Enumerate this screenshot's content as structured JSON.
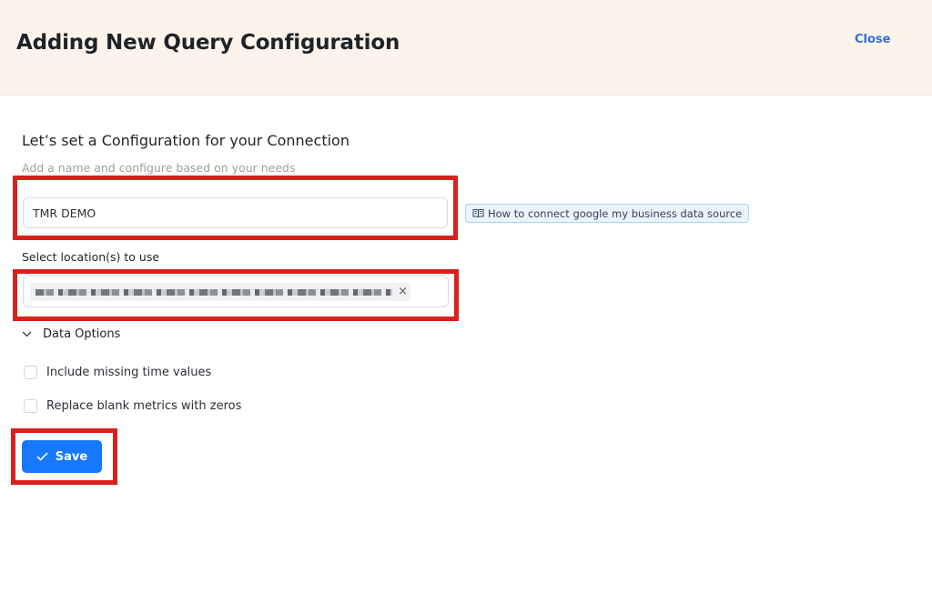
{
  "header": {
    "title": "Adding New Query Configuration",
    "close_label": "Close",
    "background_color": "#fcf3ea",
    "link_color": "#2f6fdd"
  },
  "form": {
    "title": "Let’s set a Configuration for your Connection",
    "subtitle": "Add a name and configure based on your needs",
    "name_value": "TMR DEMO",
    "help_link": {
      "icon": "book-icon",
      "label": "How to connect google my business data source"
    },
    "location_label": "Select location(s) to use",
    "location_remove_glyph": "×",
    "data_options_label": "Data Options",
    "options": [
      {
        "label": "Include missing time values",
        "checked": false
      },
      {
        "label": "Replace blank metrics with zeros",
        "checked": false
      }
    ],
    "save_label": "Save",
    "accent_color": "#1677ff",
    "annotation_color": "#d7211b"
  }
}
